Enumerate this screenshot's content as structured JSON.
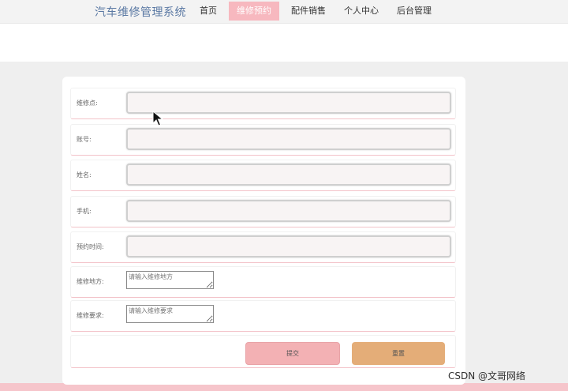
{
  "header": {
    "brand": "汽车维修管理系统",
    "nav": [
      {
        "label": "首页"
      },
      {
        "label": "维修预约"
      },
      {
        "label": "配件销售"
      },
      {
        "label": "个人中心"
      },
      {
        "label": "后台管理"
      }
    ],
    "active_nav": "维修预约"
  },
  "form": {
    "fields": [
      {
        "label": "维修点:",
        "value": ""
      },
      {
        "label": "账号:",
        "value": ""
      },
      {
        "label": "姓名:",
        "value": ""
      },
      {
        "label": "手机:",
        "value": ""
      },
      {
        "label": "预约时间:",
        "value": ""
      }
    ],
    "textareas": [
      {
        "label": "维修地方:",
        "placeholder": "请输入维修地方"
      },
      {
        "label": "维修要求:",
        "placeholder": "请输入维修要求"
      }
    ],
    "buttons": {
      "submit": "提交",
      "reset": "重置"
    }
  },
  "watermark": "CSDN @文哥网络",
  "colors": {
    "nav_active": "#f7b8bf",
    "submit_button": "#f3b1b4",
    "reset_button": "#e4ad78",
    "row_accent": "#f3c3c9",
    "background": "#efefef"
  },
  "icons": [
    "mouse-pointer-icon"
  ]
}
